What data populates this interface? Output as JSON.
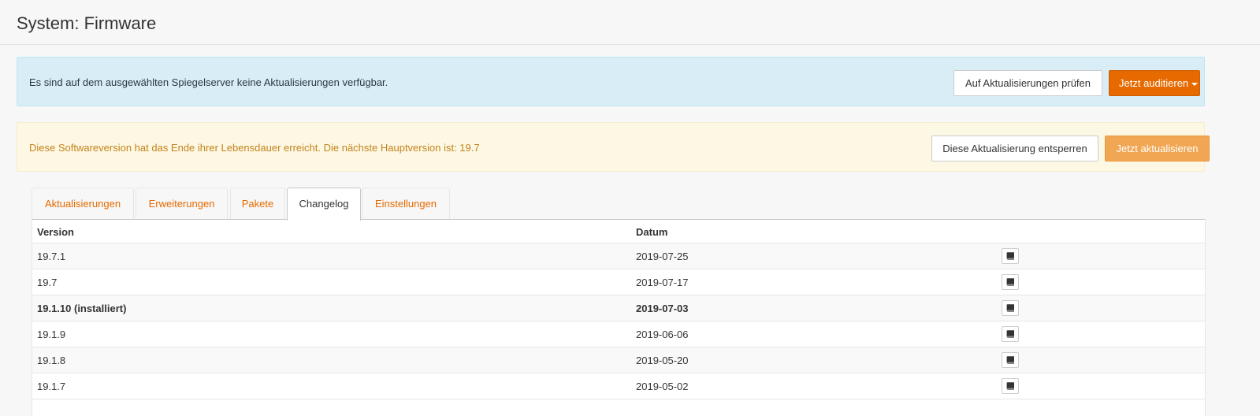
{
  "header": {
    "title": "System: Firmware"
  },
  "alerts": {
    "info": {
      "message": "Es sind auf dem ausgewählten Spiegelserver keine Aktualisierungen verfügbar.",
      "check_button": "Auf Aktualisierungen prüfen",
      "audit_button": "Jetzt auditieren"
    },
    "warning": {
      "message": "Diese Softwareversion hat das Ende ihrer Lebensdauer erreicht. Die nächste Hauptversion ist: 19.7",
      "unlock_button": "Diese Aktualisierung entsperren",
      "update_button": "Jetzt aktualisieren"
    }
  },
  "tabs": [
    {
      "label": "Aktualisierungen",
      "active": false
    },
    {
      "label": "Erweiterungen",
      "active": false
    },
    {
      "label": "Pakete",
      "active": false
    },
    {
      "label": "Changelog",
      "active": true
    },
    {
      "label": "Einstellungen",
      "active": false
    }
  ],
  "table": {
    "columns": [
      "Version",
      "Datum"
    ],
    "rows": [
      {
        "version": "19.7.1",
        "date": "2019-07-25",
        "icon": "book-icon"
      },
      {
        "version": "19.7",
        "date": "2019-07-17",
        "icon": "book-icon"
      },
      {
        "version": "19.1.10 (installiert)",
        "date": "2019-07-03",
        "icon": "book-icon",
        "installed": true
      },
      {
        "version": "19.1.9",
        "date": "2019-06-06",
        "icon": "book-icon"
      },
      {
        "version": "19.1.8",
        "date": "2019-05-20",
        "icon": "book-icon"
      },
      {
        "version": "19.1.7",
        "date": "2019-05-02",
        "icon": "book-icon"
      }
    ]
  },
  "colors": {
    "accent": "#e66a00",
    "accent_light": "#f0a652",
    "info_bg": "#d9edf7",
    "warning_bg": "#fcf8e3",
    "warning_text": "#c7821c"
  }
}
